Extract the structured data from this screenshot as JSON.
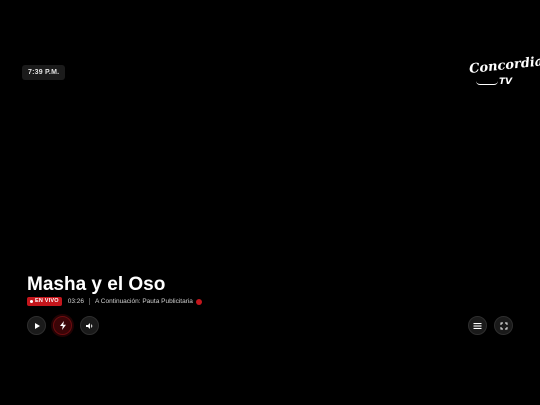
{
  "clock": {
    "time": "7:39 P.M."
  },
  "brand": {
    "logo_script": "Concordia",
    "logo_suffix": "TV"
  },
  "program": {
    "title": "Masha y el Oso",
    "live_label": "EN VIVO",
    "elapsed": "03:26",
    "next_up": "A Continuación: Pauta Publicitaria"
  },
  "controls": {
    "left": [
      "play-icon",
      "lightning-icon",
      "volume-icon"
    ],
    "right": [
      "menu-icon",
      "fullscreen-icon"
    ]
  },
  "colors": {
    "background": "#000000",
    "accent_red": "#c4161c",
    "control_bg": "#1a1a1a",
    "text": "#ffffff"
  }
}
